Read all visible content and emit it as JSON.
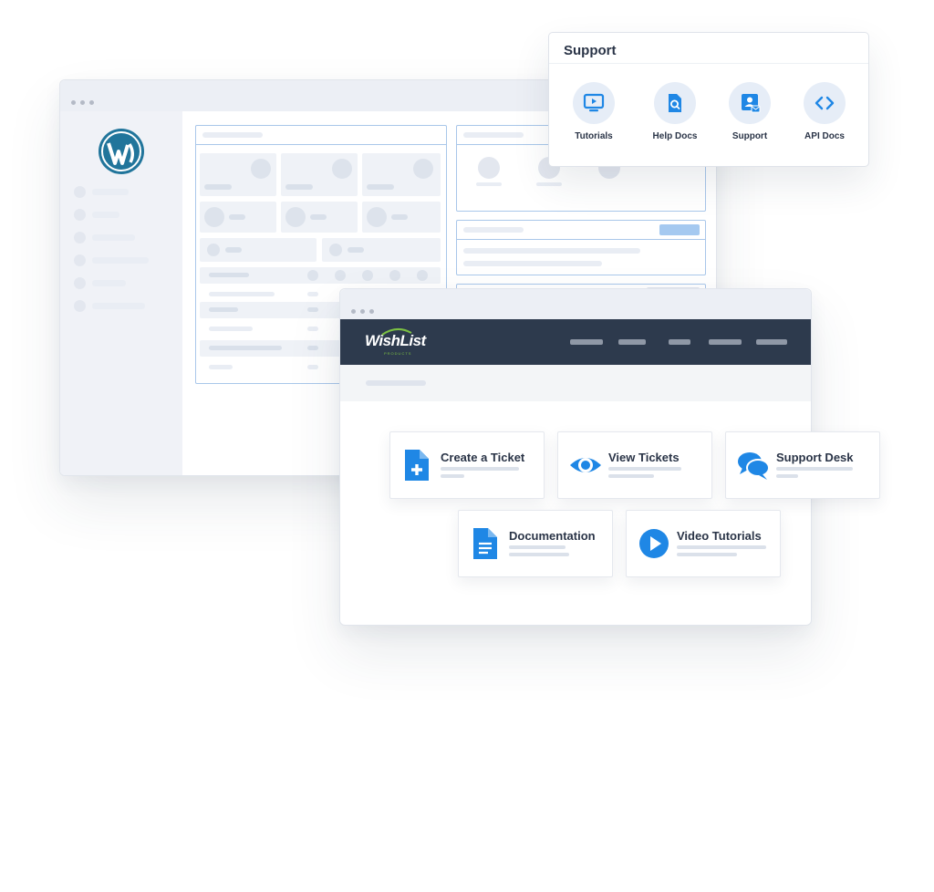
{
  "support_panel": {
    "title": "Support",
    "items": [
      {
        "label": "Tutorials",
        "icon": "play-screen-icon"
      },
      {
        "label": "Help Docs",
        "icon": "doc-search-icon"
      },
      {
        "label": "Support",
        "icon": "contact-card-icon"
      },
      {
        "label": "API Docs",
        "icon": "code-brackets-icon"
      }
    ]
  },
  "wishlist": {
    "logo": "WishList",
    "logo_sub": "PRODUCTS",
    "cards": [
      {
        "label": "Create a Ticket",
        "icon": "new-document-icon"
      },
      {
        "label": "View Tickets",
        "icon": "eye-icon"
      },
      {
        "label": "Support Desk",
        "icon": "chat-bubbles-icon"
      },
      {
        "label": "Documentation",
        "icon": "document-icon"
      },
      {
        "label": "Video Tutorials",
        "icon": "play-circle-icon"
      }
    ]
  },
  "colors": {
    "accent": "#1f87e5",
    "nav_bg": "#2d3a4d",
    "wordpress": "#21759b"
  }
}
